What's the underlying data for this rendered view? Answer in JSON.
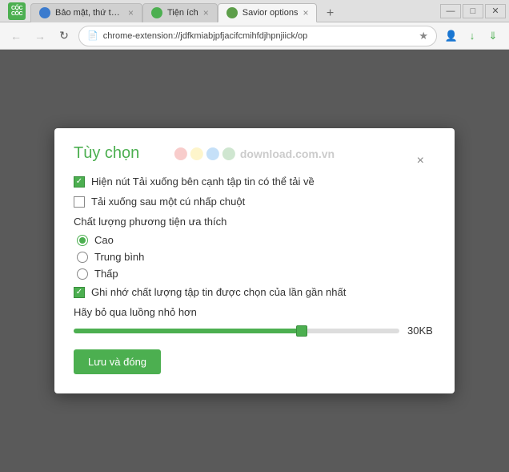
{
  "window": {
    "title": "Savior options",
    "controls": {
      "minimize": "—",
      "maximize": "□",
      "close": "✕"
    }
  },
  "tabs": [
    {
      "id": "tab1",
      "label": "Bảo mật, thứ th...",
      "icon": "blue",
      "active": false,
      "closable": true
    },
    {
      "id": "tab2",
      "label": "Tiện ích",
      "icon": "green",
      "active": false,
      "closable": true
    },
    {
      "id": "tab3",
      "label": "Savior options",
      "icon": "savior",
      "active": true,
      "closable": true
    }
  ],
  "nav": {
    "address": "chrome-extension://jdfkmiabjpfjacifcmihfdjhpnjiick/op",
    "back_disabled": true,
    "forward_disabled": true
  },
  "dialog": {
    "title": "Tùy chọn",
    "close_label": "×",
    "watermark": {
      "text": "download.com.vn",
      "circles": [
        "red",
        "yellow",
        "blue",
        "green"
      ]
    },
    "checkbox1": {
      "checked": true,
      "label": "Hiện nút Tải xuống bên cạnh tập tin có thể tải về"
    },
    "checkbox2": {
      "checked": false,
      "label": "Tải xuống sau một cú nhấp chuột"
    },
    "quality_section": {
      "label": "Chất lượng phương tiện ưa thích",
      "options": [
        {
          "id": "cao",
          "label": "Cao",
          "selected": true
        },
        {
          "id": "trung_binh",
          "label": "Trung bình",
          "selected": false
        },
        {
          "id": "thap",
          "label": "Thấp",
          "selected": false
        }
      ]
    },
    "checkbox3": {
      "checked": true,
      "label": "Ghi nhớ chất lượng tập tin được chọn của lần gần nhất"
    },
    "slider_section": {
      "label": "Hãy bỏ qua luồng nhỏ hơn",
      "value": "30KB",
      "fill_percent": 70
    },
    "save_button": "Lưu và đóng"
  }
}
